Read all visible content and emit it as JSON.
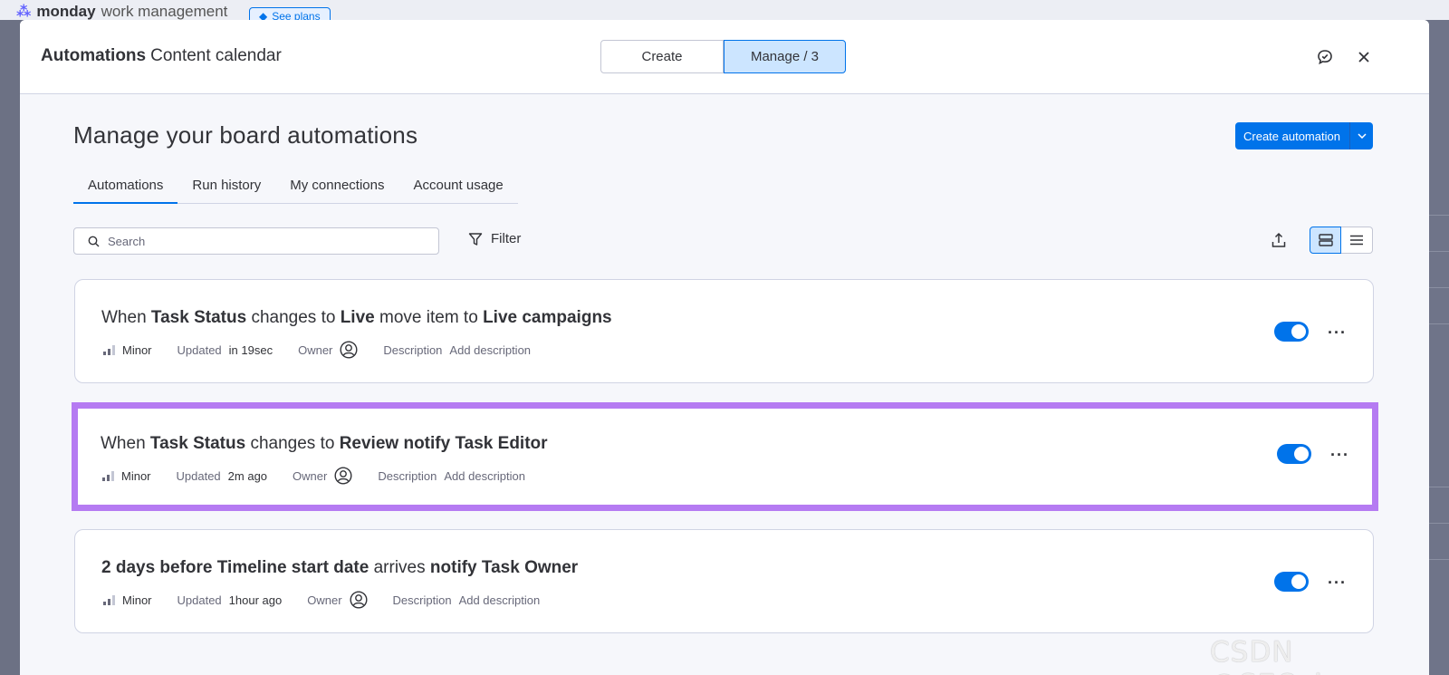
{
  "background_app": {
    "logo_bold": "monday",
    "logo_light": "work management",
    "see_plans_label": "See plans"
  },
  "dialog": {
    "title_bold": "Automations",
    "title_board": "Content calendar",
    "segment_create": "Create",
    "segment_manage": "Manage / 3"
  },
  "page": {
    "title": "Manage your board automations",
    "create_automation_label": "Create automation",
    "tabs": [
      "Automations",
      "Run history",
      "My connections",
      "Account usage"
    ],
    "active_tab": "Automations",
    "search_placeholder": "Search",
    "filter_label": "Filter"
  },
  "automations": [
    {
      "recipe": [
        {
          "t": "When ",
          "b": false
        },
        {
          "t": "Task Status",
          "b": true
        },
        {
          "t": " changes to ",
          "b": false
        },
        {
          "t": "Live",
          "b": true
        },
        {
          "t": " move item to ",
          "b": false
        },
        {
          "t": "Live campaigns",
          "b": true
        }
      ],
      "impact": "Minor",
      "updated_label": "Updated",
      "updated_value": "in 19sec",
      "owner_label": "Owner",
      "description_label": "Description",
      "description_action": "Add description",
      "enabled": true
    },
    {
      "recipe": [
        {
          "t": "When ",
          "b": false
        },
        {
          "t": "Task Status",
          "b": true
        },
        {
          "t": " changes to ",
          "b": false
        },
        {
          "t": "Review",
          "b": true
        },
        {
          "t": " notify ",
          "b": true
        },
        {
          "t": "Task Editor",
          "b": true
        }
      ],
      "impact": "Minor",
      "updated_label": "Updated",
      "updated_value": "2m ago",
      "owner_label": "Owner",
      "description_label": "Description",
      "description_action": "Add description",
      "enabled": true
    },
    {
      "recipe": [
        {
          "t": "2 days before ",
          "b": true
        },
        {
          "t": "Timeline start date",
          "b": true
        },
        {
          "t": " arrives ",
          "b": false
        },
        {
          "t": "notify ",
          "b": true
        },
        {
          "t": "Task Owner",
          "b": true
        }
      ],
      "impact": "Minor",
      "updated_label": "Updated",
      "updated_value": "1hour ago",
      "owner_label": "Owner",
      "description_label": "Description",
      "description_action": "Add description",
      "enabled": true
    }
  ],
  "colors": {
    "accent": "#0073ea",
    "highlight_border": "#b57bf2"
  },
  "watermark": "CSDN @SEO_juper"
}
